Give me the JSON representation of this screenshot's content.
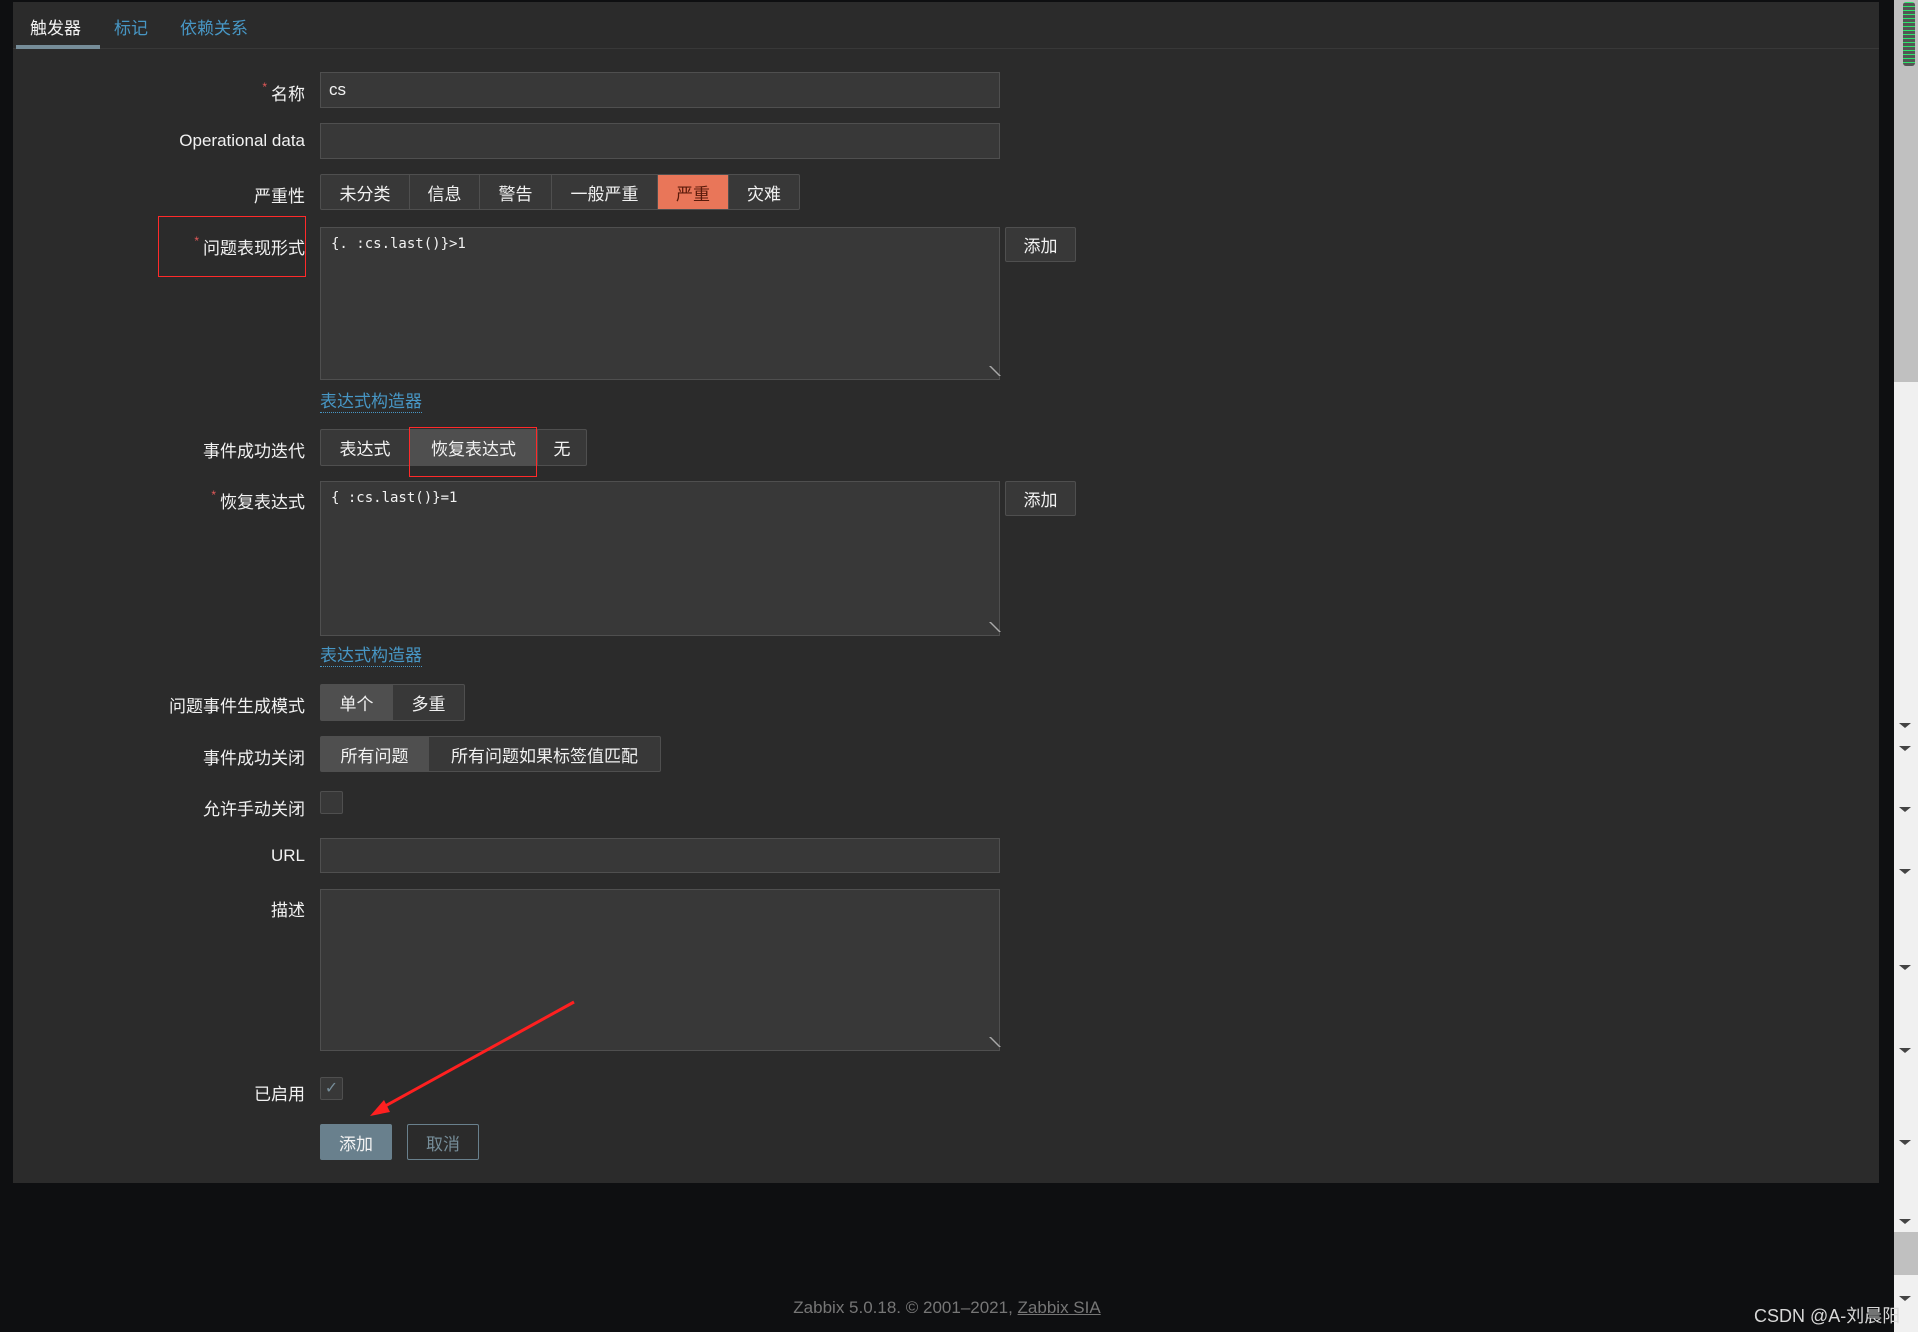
{
  "tabs": [
    "触发器",
    "标记",
    "依赖关系"
  ],
  "form": {
    "name_label": "名称",
    "name_value": "cs",
    "opdata_label": "Operational data",
    "opdata_value": "",
    "severity_label": "严重性",
    "severity_options": [
      "未分类",
      "信息",
      "警告",
      "一般严重",
      "严重",
      "灾难"
    ],
    "severity_selected": "严重",
    "problem_label": "问题表现形式",
    "problem_value": "{.   :cs.last()}>1",
    "add_label": "添加",
    "constructor_link": "表达式构造器",
    "ok_event_label": "事件成功迭代",
    "ok_event_options": [
      "表达式",
      "恢复表达式",
      "无"
    ],
    "ok_event_selected": "恢复表达式",
    "recovery_label": "恢复表达式",
    "recovery_value": "{   :cs.last()}=1",
    "gen_mode_label": "问题事件生成模式",
    "gen_mode_options": [
      "单个",
      "多重"
    ],
    "gen_mode_selected": "单个",
    "ok_close_label": "事件成功关闭",
    "ok_close_options": [
      "所有问题",
      "所有问题如果标签值匹配"
    ],
    "ok_close_selected": "所有问题",
    "manual_close_label": "允许手动关闭",
    "manual_close_checked": false,
    "url_label": "URL",
    "url_value": "",
    "desc_label": "描述",
    "desc_value": "",
    "enabled_label": "已启用",
    "enabled_checked": true,
    "submit_label": "添加",
    "cancel_label": "取消"
  },
  "colors": {
    "severity_high": "#e97659",
    "link": "#4796c4",
    "primary": "#69808d"
  },
  "footer": {
    "text": "Zabbix 5.0.18. © 2001–2021, ",
    "link": "Zabbix SIA"
  },
  "watermark": "CSDN @A-刘晨阳"
}
